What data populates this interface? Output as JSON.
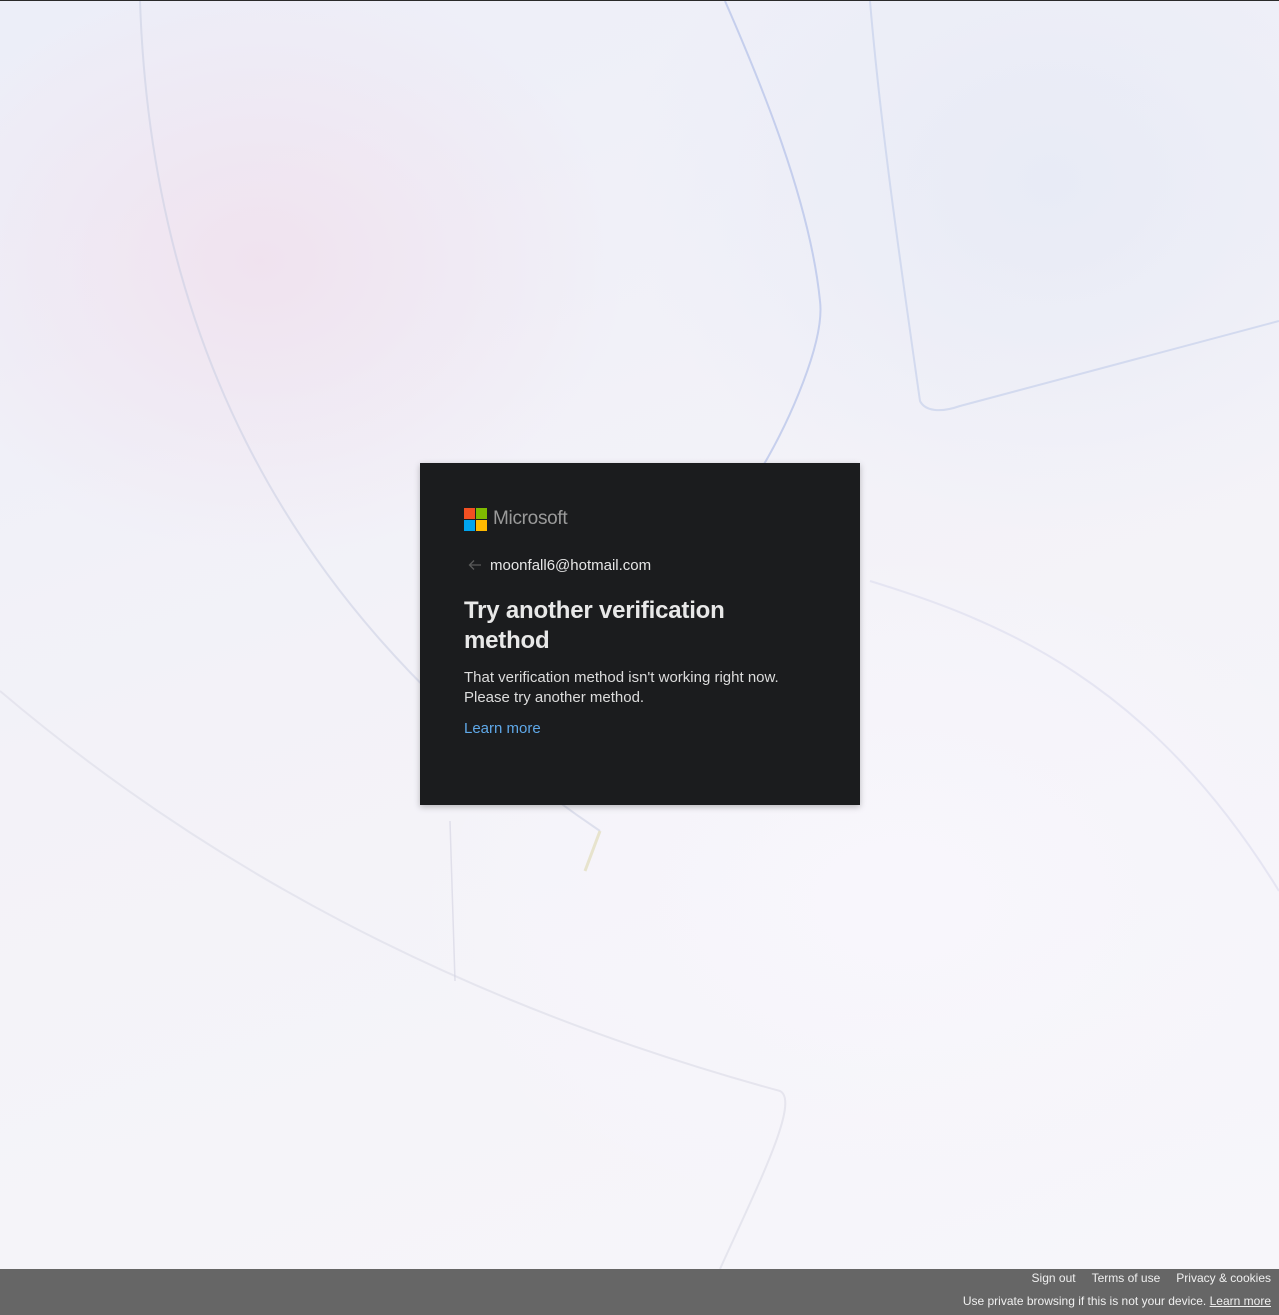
{
  "logo": {
    "wordmark": "Microsoft",
    "colors": [
      "#f25022",
      "#7fba00",
      "#00a4ef",
      "#ffb900"
    ]
  },
  "identity": {
    "email": "moonfall6@hotmail.com",
    "back_icon": "arrow-left-icon"
  },
  "dialog": {
    "title": "Try another verification method",
    "description_line1": "That verification method isn't working right now.",
    "description_line2": "Please try another method.",
    "learn_more": "Learn more"
  },
  "footer": {
    "sign_out": "Sign out",
    "terms": "Terms of use",
    "privacy": "Privacy & cookies",
    "note": "Use private browsing if this is not your device.",
    "note_link": "Learn more"
  },
  "colors": {
    "card_bg": "#1b1c1e",
    "link": "#5fa8e8",
    "footer_bg": "#666666"
  }
}
